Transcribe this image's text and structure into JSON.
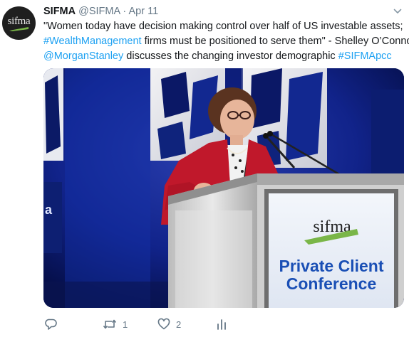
{
  "tweet": {
    "author_name": "SIFMA",
    "author_handle": "@SIFMA",
    "separator": "·",
    "date": "Apr 11",
    "avatar_logo_text": "sifma",
    "text_lines": [
      [
        {
          "text": "\"Women today have decision making control over half of US investable assets;",
          "link": false
        }
      ],
      [
        {
          "text": "#WealthManagement",
          "link": true
        },
        {
          "text": " firms must be positioned to serve them\" - Shelley O'Connor",
          "link": false
        }
      ],
      [
        {
          "text": "@MorganStanley",
          "link": true
        },
        {
          "text": " discusses the changing investor demographic ",
          "link": false
        },
        {
          "text": "#SIFMApcc",
          "link": true
        }
      ]
    ],
    "line1": "\"Women today have decision making control over half of US investable assets;",
    "line2_hashtag": "#WealthManagement",
    "line2_rest": " firms must be positioned to serve them\" - Shelley O’Connor",
    "line3_mention": "@MorganStanley",
    "line3_rest": " discusses the changing investor demographic ",
    "line3_hashtag": "#SIFMApcc",
    "media": {
      "podium_logo": "sifma",
      "podium_title_line1": "Private Client",
      "podium_title_line2": "Conference"
    },
    "actions": {
      "reply_count": "",
      "retweet_count": "1",
      "like_count": "2"
    },
    "colors": {
      "link": "#1da1f2",
      "secondary_text": "#657786",
      "stage_blue": "#0a1d6e",
      "podium_text": "#1a4fb5",
      "jacket_red": "#c0182b"
    },
    "icons": [
      "chevron-down-icon",
      "reply-icon",
      "retweet-icon",
      "like-icon",
      "analytics-icon"
    ]
  }
}
